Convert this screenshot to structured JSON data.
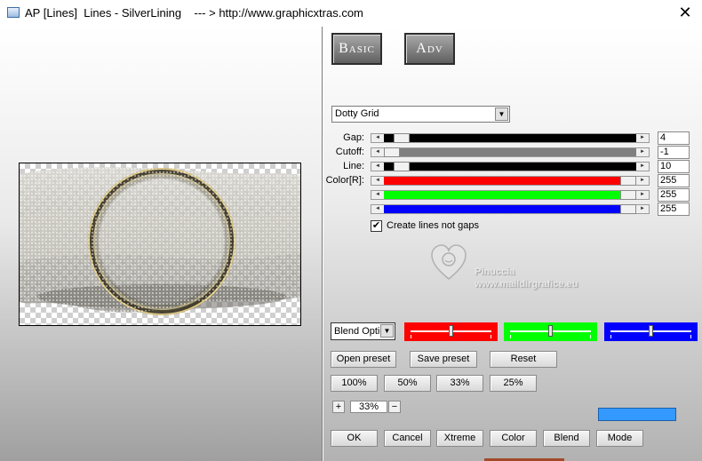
{
  "window": {
    "title": "AP [Lines]  Lines - SilverLining    --- > http://www.graphicxtras.com",
    "close_glyph": "✕"
  },
  "tabs": {
    "basic": "Basic",
    "adv": "Adv"
  },
  "style_dropdown": {
    "value": "Dotty Grid",
    "arrow": "▼"
  },
  "sliders": [
    {
      "label": "Gap:",
      "value": "4",
      "fill_color": "#000000",
      "level": 0.04
    },
    {
      "label": "Cutoff:",
      "value": "-1",
      "fill_color": "#808080",
      "level": 0.0
    },
    {
      "label": "Line:",
      "value": "10",
      "fill_color": "#000000",
      "level": 0.04
    },
    {
      "label": "Color[R]:",
      "value": "255",
      "fill_color": "#ff0000",
      "level": 1.0
    },
    {
      "label": "",
      "value": "255",
      "fill_color": "#00ff00",
      "level": 1.0
    },
    {
      "label": "",
      "value": "255",
      "fill_color": "#0000ff",
      "level": 1.0
    }
  ],
  "arrows": {
    "left": "◄",
    "right": "►"
  },
  "checkbox": {
    "label": "Create lines not gaps",
    "checked": "✔"
  },
  "watermark": {
    "line1": "Pinuccia",
    "line2": "www.maildirgrafice.eu"
  },
  "blend": {
    "select_value": "Blend Optio",
    "arrow": "▼",
    "channels": [
      {
        "color": "#ff0000",
        "level": 0.5
      },
      {
        "color": "#00ff00",
        "level": 0.5
      },
      {
        "color": "#0000ff",
        "level": 0.5
      }
    ]
  },
  "preset_buttons": {
    "open": "Open preset",
    "save": "Save preset",
    "reset": "Reset"
  },
  "zoom_buttons": [
    "100%",
    "50%",
    "33%",
    "25%"
  ],
  "zoom": {
    "plus": "+",
    "value": "33%",
    "minus": "−"
  },
  "swatch_color": "#3399ff",
  "bottom_buttons": {
    "ok": "OK",
    "cancel": "Cancel",
    "xtreme": "Xtreme",
    "color": "Color",
    "blend": "Blend",
    "mode": "Mode"
  }
}
